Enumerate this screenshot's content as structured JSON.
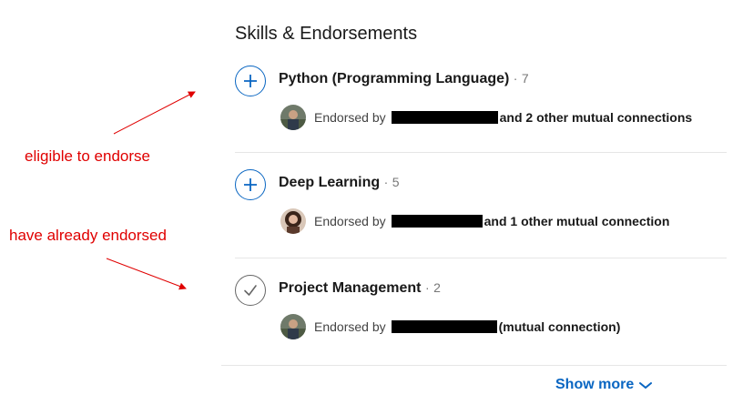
{
  "section": {
    "title": "Skills & Endorsements"
  },
  "skills": [
    {
      "name": "Python (Programming Language)",
      "separator": "·",
      "count": "7",
      "button_icon": "plus-icon",
      "endorsed_label": "Endorsed by",
      "endorsed_rest": "and 2 other mutual connections",
      "avatar_icon": "avatar"
    },
    {
      "name": "Deep Learning",
      "separator": "·",
      "count": "5",
      "button_icon": "plus-icon",
      "endorsed_label": "Endorsed by",
      "endorsed_rest": "and 1 other mutual connection",
      "avatar_icon": "avatar"
    },
    {
      "name": "Project Management",
      "separator": "·",
      "count": "2",
      "button_icon": "check-icon",
      "endorsed_label": "Endorsed by",
      "endorsed_rest": "(mutual connection)",
      "avatar_icon": "avatar"
    }
  ],
  "footer": {
    "show_more": "Show more",
    "icon": "chevron-down-icon"
  },
  "annotations": {
    "eligible": "eligible to endorse",
    "already": "have already endorsed"
  },
  "colors": {
    "accent": "#0a66c2",
    "annotation": "#e00000",
    "redaction": "#000000"
  }
}
